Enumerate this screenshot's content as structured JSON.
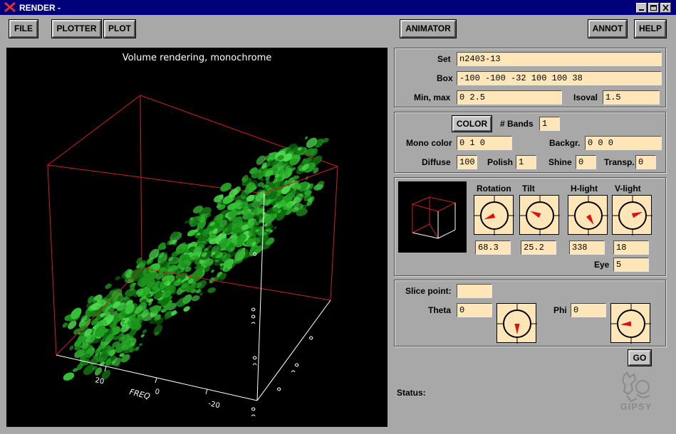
{
  "window": {
    "title": "RENDER -"
  },
  "menu": {
    "file": "FILE",
    "plotter": "PLOTTER",
    "plot": "PLOT",
    "animator": "ANIMATOR",
    "annot": "ANNOT",
    "help": "HELP"
  },
  "canvas": {
    "title": "Volume rendering, monochrome",
    "axis_name": "FREQ",
    "tick_labels": [
      "20",
      "0",
      "-20"
    ],
    "box_color": "#d02020",
    "cloud_color": "#1fa21f"
  },
  "set_panel": {
    "set_label": "Set",
    "set_value": "n2403-13",
    "box_label": "Box",
    "box_value": "-100 -100 -32 100 100 38",
    "minmax_label": "Min, max",
    "minmax_value": "0 2.5",
    "isoval_label": "Isoval",
    "isoval_value": "1.5"
  },
  "color_panel": {
    "color_button": "COLOR",
    "bands_label": "# Bands",
    "bands_value": "1",
    "mono_label": "Mono color",
    "mono_value": "0 1 0",
    "backgr_label": "Backgr.",
    "backgr_value": "0 0 0",
    "diffuse_label": "Diffuse",
    "diffuse_value": "100",
    "polish_label": "Polish",
    "polish_value": "1",
    "shine_label": "Shine",
    "shine_value": "0",
    "transp_label": "Transp.",
    "transp_value": "0"
  },
  "view_panel": {
    "rotation_label": "Rotation",
    "rotation_value": "68.3",
    "tilt_label": "Tilt",
    "tilt_value": "25.2",
    "hlight_label": "H-light",
    "hlight_value": "338",
    "vlight_label": "V-light",
    "vlight_value": "18",
    "eye_label": "Eye",
    "eye_value": "5"
  },
  "slice_panel": {
    "slice_label": "Slice point:",
    "slice_value": "",
    "theta_label": "Theta",
    "theta_value": "0",
    "phi_label": "Phi",
    "phi_value": "0"
  },
  "go_button": "GO",
  "status": {
    "label": "Status:",
    "value": ""
  },
  "logo": {
    "text": "GIPSY"
  },
  "colors": {
    "field_bg": "#ffe6b8",
    "window_bg": "#a8a8a8",
    "titlebar": "#00007b",
    "dial_pointer": "#e01010"
  }
}
